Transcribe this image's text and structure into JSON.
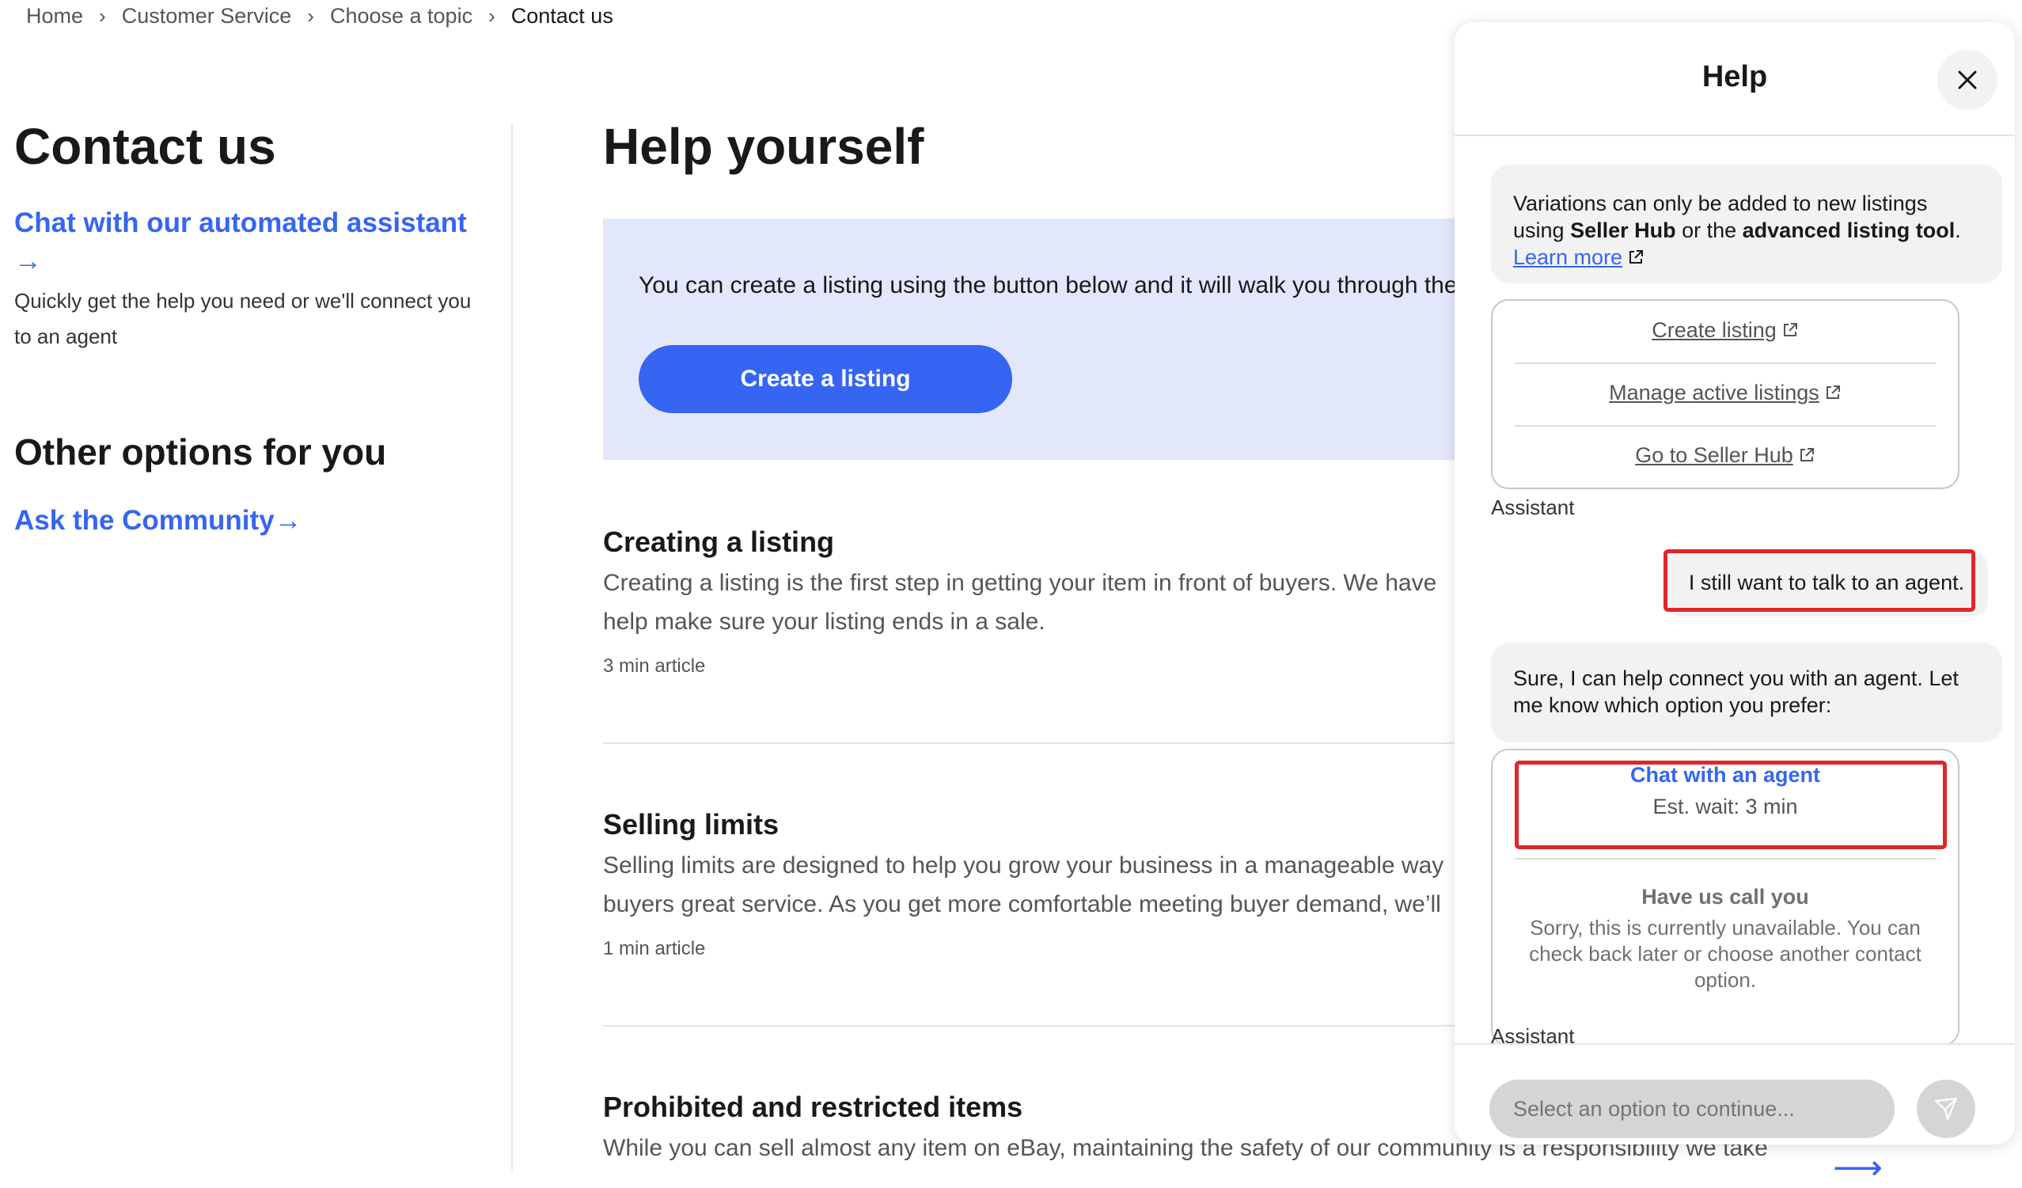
{
  "breadcrumb": {
    "items": [
      "Home",
      "Customer Service",
      "Choose a topic"
    ],
    "current": "Contact us"
  },
  "left": {
    "title": "Contact us",
    "assistant_link": "Chat with our automated assistant",
    "assistant_desc": "Quickly get the help you need or we'll connect you to an agent",
    "other_title": "Other options for you",
    "community_link": "Ask the Community"
  },
  "main": {
    "title": "Help yourself",
    "banner_text": "You can create a listing using the button below and it will walk you through the process.",
    "banner_button": "Create a listing",
    "articles": [
      {
        "title": "Creating a listing",
        "line1": "Creating a listing is the first step in getting your item in front of buyers. We have",
        "line2": "help make sure your listing ends in a sale.",
        "meta": "3 min article"
      },
      {
        "title": "Selling limits",
        "line1": "Selling limits are designed to help you grow your business in a manageable way",
        "line2": "buyers great service. As you get more comfortable meeting buyer demand, we’ll",
        "meta": "1 min article"
      },
      {
        "title": "Prohibited and restricted items",
        "line1": "While you can sell almost any item on eBay, maintaining the safety of our community is a responsibility we take"
      }
    ]
  },
  "panel": {
    "title": "Help",
    "msg1": {
      "part1": "Variations can only be added to new listings using ",
      "bold1": "Seller Hub",
      "part2": " or the ",
      "bold2": "advanced listing tool",
      "part3": ". ",
      "link": "Learn more"
    },
    "options1": [
      "Create listing",
      "Manage active listings",
      "Go to Seller Hub"
    ],
    "sender_assistant": "Assistant",
    "user_msg": "I still want to talk to an agent.",
    "msg2": "Sure, I can help connect you with an agent. Let me know which option you prefer:",
    "chat_agent": {
      "label": "Chat with an agent",
      "wait": "Est. wait: 3 min"
    },
    "call_you": {
      "label": "Have us call you",
      "desc": "Sorry, this is currently unavailable. You can check back later or choose another contact option."
    },
    "input_placeholder": "Select an option to continue..."
  },
  "colors": {
    "accent": "#3665f3",
    "highlight": "#e0262b",
    "banner": "#e2e7fb"
  }
}
